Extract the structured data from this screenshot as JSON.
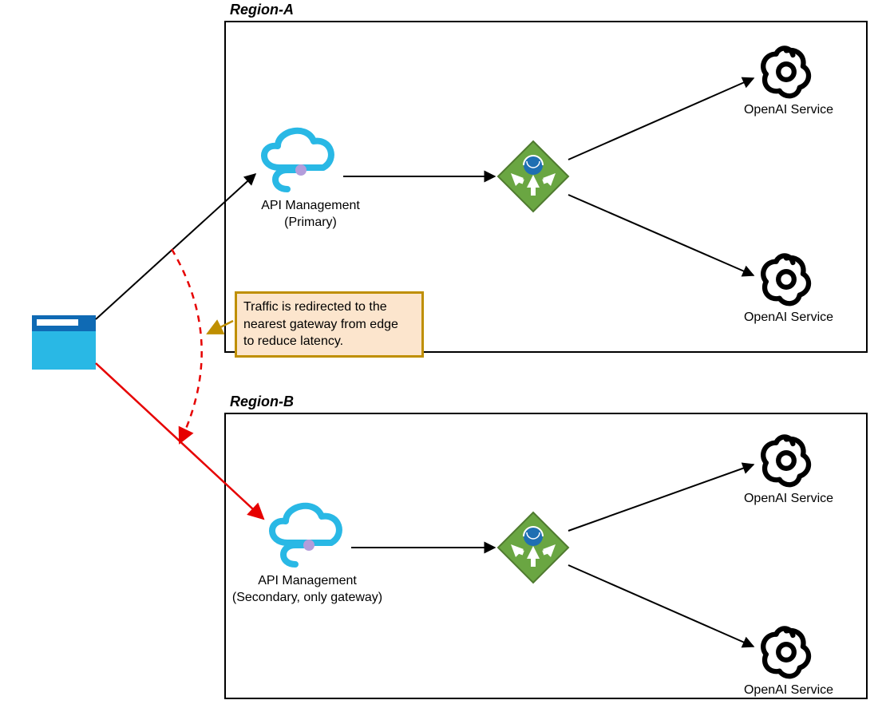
{
  "regions": {
    "a": {
      "title": "Region-A"
    },
    "b": {
      "title": "Region-B"
    }
  },
  "nodes": {
    "client": {
      "name": "browser-client"
    },
    "apimA": {
      "label_line1": "API Management",
      "label_line2": "(Primary)"
    },
    "apimB": {
      "label_line1": "API Management",
      "label_line2": "(Secondary, only gateway)"
    },
    "lbA": {
      "name": "load-balancer-a"
    },
    "lbB": {
      "name": "load-balancer-b"
    },
    "openaiA1": {
      "label": "OpenAI Service"
    },
    "openaiA2": {
      "label": "OpenAI Service"
    },
    "openaiB1": {
      "label": "OpenAI Service"
    },
    "openaiB2": {
      "label": "OpenAI Service"
    }
  },
  "note": {
    "line1": "Traffic is redirected to the",
    "line2": "nearest gateway from edge",
    "line3": "to reduce latency."
  },
  "colors": {
    "note_border": "#BF8F00",
    "note_fill": "#FCE5CD",
    "red": "#E60000",
    "blue": "#29B8E5",
    "green": "#6AA642"
  }
}
